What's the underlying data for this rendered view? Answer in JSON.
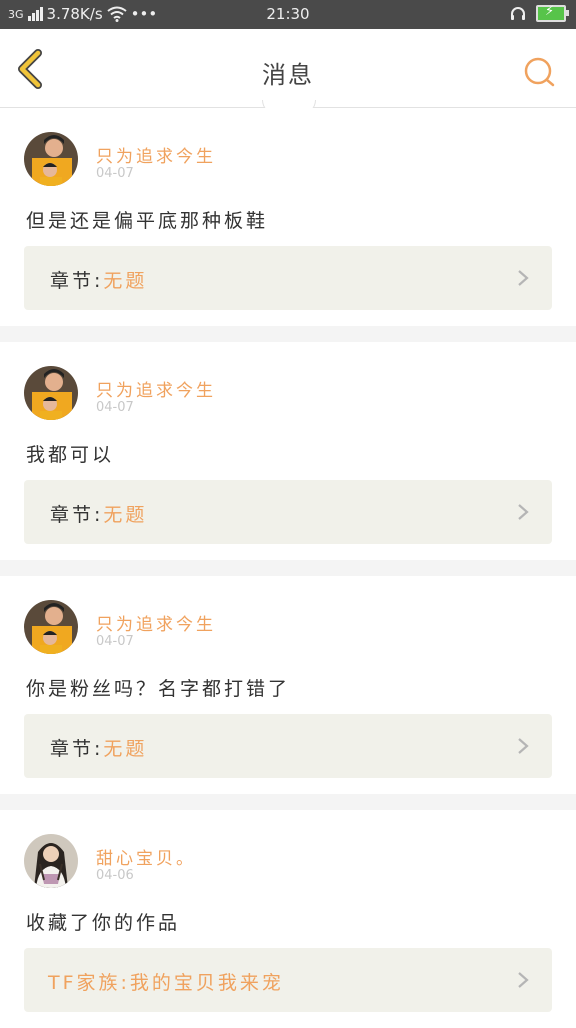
{
  "status_bar": {
    "network": "3G",
    "speed": "3.78K/s",
    "more": "•••",
    "time": "21:30"
  },
  "header": {
    "title": "消息"
  },
  "icons": {
    "back": "chevron-left-icon",
    "search": "search-icon",
    "chapter_arrow": "chevron-right-icon",
    "headphones": "headphones-icon",
    "wifi": "wifi-icon",
    "battery": "battery-charging-icon"
  },
  "colors": {
    "accent": "#f0a25e",
    "back_icon": "#f0c43a",
    "status_bar_bg": "#4a4a4a"
  },
  "messages": [
    {
      "username": "只为追求今生",
      "date": "04-07",
      "content": "但是还是偏平底那种板鞋",
      "link_prefix": "章节:",
      "link_value": "无题"
    },
    {
      "username": "只为追求今生",
      "date": "04-07",
      "content": "我都可以",
      "link_prefix": "章节:",
      "link_value": "无题"
    },
    {
      "username": "只为追求今生",
      "date": "04-07",
      "content": "你是粉丝吗？名字都打错了",
      "link_prefix": "章节:",
      "link_value": "无题"
    },
    {
      "username": "甜心宝贝。",
      "date": "04-06",
      "content": "收藏了你的作品",
      "link_text": "TF家族:我的宝贝我来宠"
    }
  ]
}
